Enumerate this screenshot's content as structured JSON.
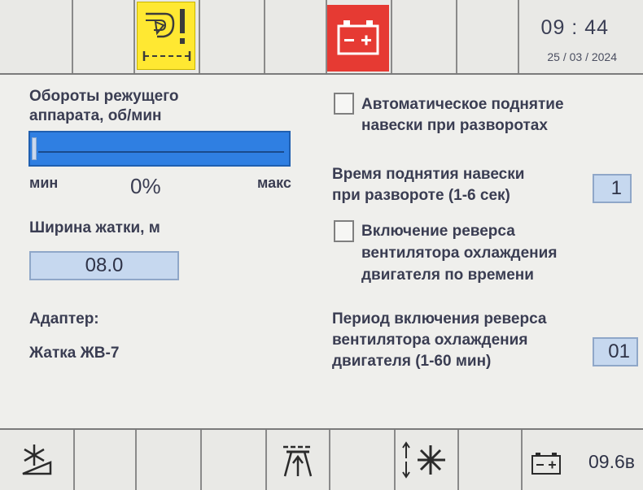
{
  "status_bar": {
    "time": "09 : 44",
    "date": "25 / 03 / 2024",
    "icons": [
      "cutter-engagement-warning-icon",
      "battery-warning-icon"
    ],
    "colors": {
      "warning_yellow": "#ffe832",
      "alarm_red": "#e63a33"
    }
  },
  "cutter_speed": {
    "label_line1": "Обороты режущего",
    "label_line2": "аппарата, об/мин",
    "min_label": "мин",
    "max_label": "макс",
    "percent_text": "0%",
    "percent_value": 0
  },
  "header_width": {
    "label": "Ширина жатки, м",
    "value": "08.0"
  },
  "adapter": {
    "label": "Адаптер:",
    "value": "Жатка ЖВ-7"
  },
  "auto_lift": {
    "label_line1": "Автоматическое поднятие",
    "label_line2": "навески при разворотах",
    "checked": false
  },
  "lift_time": {
    "label_line1": "Время поднятия навески",
    "label_line2": "при развороте (1-6 сек)",
    "value": "1"
  },
  "fan_reverse_timer": {
    "label_line1": "Включение реверса",
    "label_line2": "вентилятора охлаждения",
    "label_line3": "двигателя по времени",
    "checked": false
  },
  "fan_reverse_period": {
    "label_line1": "Период включения реверса",
    "label_line2": "вентилятора охлаждения",
    "label_line3": "двигателя (1-60 мин)",
    "value": "01"
  },
  "softkeys": {
    "icons": [
      "fan-speed-icon",
      "header-height-icon",
      "fan-reverse-icon",
      "battery-icon"
    ],
    "battery_voltage": "09.6в"
  }
}
